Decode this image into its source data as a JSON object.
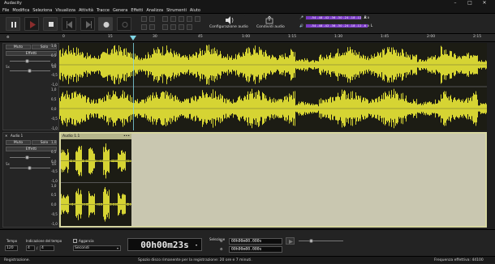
{
  "app": {
    "title": "Audacity"
  },
  "menu": [
    "File",
    "Modifica",
    "Seleziona",
    "Visualizza",
    "Attività",
    "Tracce",
    "Genera",
    "Effetti",
    "Analizza",
    "Strumenti",
    "Aiuto"
  ],
  "toolbar": {
    "audio_setup_label": "Configurazione audio",
    "share_label": "Condividi audio",
    "meter_ticks_1": "-54 -48 -42 -36 -30 -24 -18 -12 -6 0",
    "meter_ticks_2": "-54 -48 -42 -36 -30 -24 -18 -12 -6 0",
    "meter_channel_r": "R",
    "meter_channel_l": "L"
  },
  "ruler": {
    "ticks": [
      "0",
      "15",
      "30",
      "45",
      "1:00",
      "1:15",
      "1:30",
      "1:45",
      "2:00",
      "2:15"
    ]
  },
  "track1": {
    "mute": "Muto",
    "solo": "Solo",
    "effects": "Effetti",
    "pan_left": "Sx",
    "pan_right": "Dx",
    "scale": [
      "1,0",
      "0,5",
      "0,0",
      "-0,5",
      "-1,0",
      "1,0",
      "0,5",
      "0,0",
      "-0,5",
      "-1,0"
    ]
  },
  "track2": {
    "name": "Audio 1",
    "mute": "Muto",
    "solo": "Solo",
    "effects": "Effetti",
    "pan_left": "Sx",
    "pan_right": "Dx",
    "clip_name": "Audio 1.1",
    "clip_menu": "•••",
    "scale": [
      "1,0",
      "0,5",
      "0,0",
      "-0,5",
      "-1,0",
      "1,0",
      "0,5",
      "0,0",
      "-0,5",
      "-1,0"
    ]
  },
  "bottom": {
    "tempo_label": "Tempo",
    "tempo_value": "120",
    "time_sig_label": "Indicazione del tempo",
    "time_sig_num": "4",
    "time_sig_den": "4",
    "snap_label": "Aggancia",
    "snap_unit": "Secondi",
    "time_display": "00h00m23s",
    "selection_label": "Selezione",
    "sel_start": "00h00m00.000s",
    "sel_end": "00h00m00.000s"
  },
  "status": {
    "left": "Registrazione.",
    "center": "Spazio disco rimanente per la registrazione: 20 ore e 7 minuti.",
    "right": "Frequenza effettiva: 44100"
  },
  "colors": {
    "waveform": "#d6d433",
    "accent_meter": "#7b3bc7",
    "playhead": "#7fd6e6",
    "record_clip": "#b5b58c"
  }
}
